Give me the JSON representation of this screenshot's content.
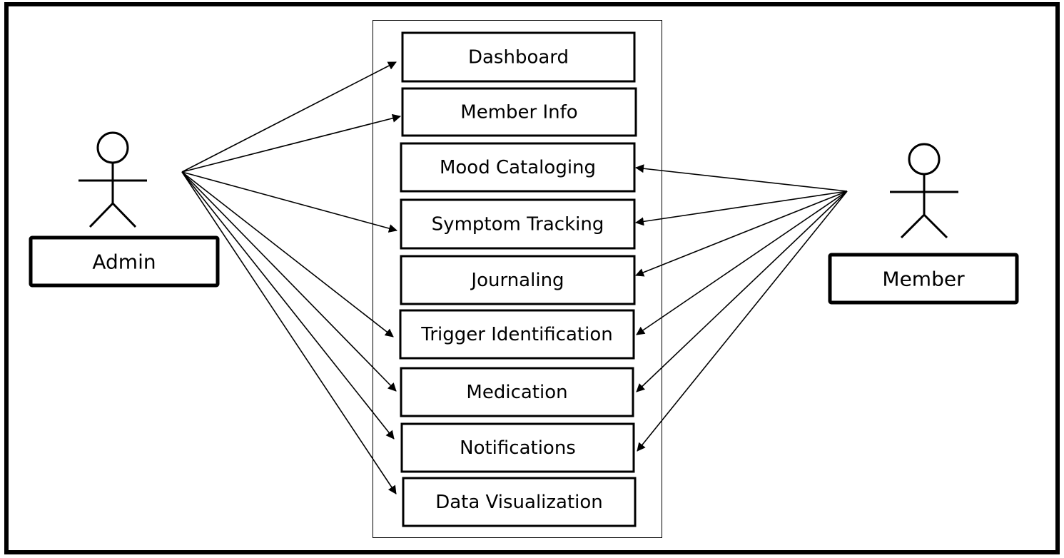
{
  "diagram": {
    "type": "use-case",
    "stroke_color": "#000000",
    "background_color": "#ffffff",
    "actors": [
      {
        "id": "admin",
        "name": "Admin",
        "side": "left"
      },
      {
        "id": "member",
        "name": "Member",
        "side": "right"
      }
    ],
    "use_cases": [
      {
        "id": "dashboard",
        "label": "Dashboard"
      },
      {
        "id": "member-info",
        "label": "Member Info"
      },
      {
        "id": "mood-cataloging",
        "label": "Mood Cataloging"
      },
      {
        "id": "symptom-tracking",
        "label": "Symptom Tracking"
      },
      {
        "id": "journaling",
        "label": "Journaling"
      },
      {
        "id": "trigger-identification",
        "label": "Trigger Identification"
      },
      {
        "id": "medication",
        "label": "Medication"
      },
      {
        "id": "notifications",
        "label": "Notifications"
      },
      {
        "id": "data-visualization",
        "label": "Data Visualization"
      }
    ],
    "associations": [
      {
        "from": "admin",
        "to": "dashboard"
      },
      {
        "from": "admin",
        "to": "member-info"
      },
      {
        "from": "admin",
        "to": "symptom-tracking"
      },
      {
        "from": "admin",
        "to": "trigger-identification"
      },
      {
        "from": "admin",
        "to": "medication"
      },
      {
        "from": "admin",
        "to": "notifications"
      },
      {
        "from": "admin",
        "to": "data-visualization"
      },
      {
        "from": "member",
        "to": "mood-cataloging"
      },
      {
        "from": "member",
        "to": "symptom-tracking"
      },
      {
        "from": "member",
        "to": "journaling"
      },
      {
        "from": "member",
        "to": "trigger-identification"
      },
      {
        "from": "member",
        "to": "medication"
      },
      {
        "from": "member",
        "to": "notifications"
      }
    ]
  }
}
